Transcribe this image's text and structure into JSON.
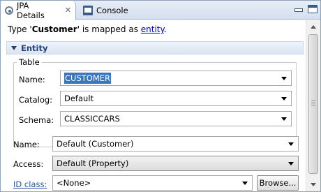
{
  "tabs": [
    {
      "label": "JPA Details",
      "close": "✕"
    },
    {
      "label": "Console"
    }
  ],
  "mapped": {
    "prefix": "Type '",
    "type_name": "Customer",
    "middle": "' is mapped as ",
    "link": "entity",
    "suffix": "."
  },
  "section": {
    "title": "Entity"
  },
  "table_group": {
    "label": "Table",
    "name_label": "Name:",
    "name_value": "CUSTOMER",
    "catalog_label": "Catalog:",
    "catalog_value": "Default",
    "schema_label": "Schema:",
    "schema_value": "CLASSICCARS"
  },
  "entity_fields": {
    "name_label": "Name:",
    "name_value": "Default (Customer)",
    "access_label": "Access:",
    "access_value": "Default (Property)",
    "idclass_label": "ID class:",
    "idclass_value": "<None>",
    "browse_label": "Browse..."
  },
  "icons": {
    "jpa_tab": "jpa-details-icon",
    "console_tab": "console-icon",
    "minimize": "minimize-icon",
    "maximize": "maximize-icon",
    "section_toggle": "collapse-triangle-icon"
  },
  "colors": {
    "selection": "#3a75c4",
    "link": "#0000cc",
    "section_title": "#24427a"
  }
}
